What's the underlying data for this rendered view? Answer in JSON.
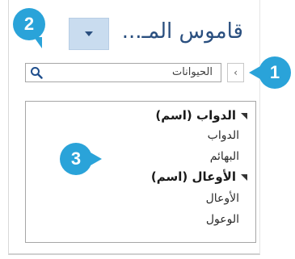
{
  "pane": {
    "title": "قاموس المـ...",
    "search_value": "الحيوانات"
  },
  "results": {
    "groups": [
      {
        "heading": "الدواب (اسم)",
        "items": [
          "الدواب",
          "البهائم"
        ]
      },
      {
        "heading": "الأوعال (اسم)",
        "items": [
          "الأوعال",
          "الوعول"
        ]
      }
    ]
  },
  "callouts": [
    "1",
    "2",
    "3"
  ],
  "colors": {
    "accent": "#2aa3d9",
    "title": "#2a4f7f",
    "dropdown_bg": "#c9dcef"
  },
  "icons": {
    "search": "search-icon",
    "dropdown": "chevron-down-icon",
    "expand": "chevron-left-icon"
  }
}
